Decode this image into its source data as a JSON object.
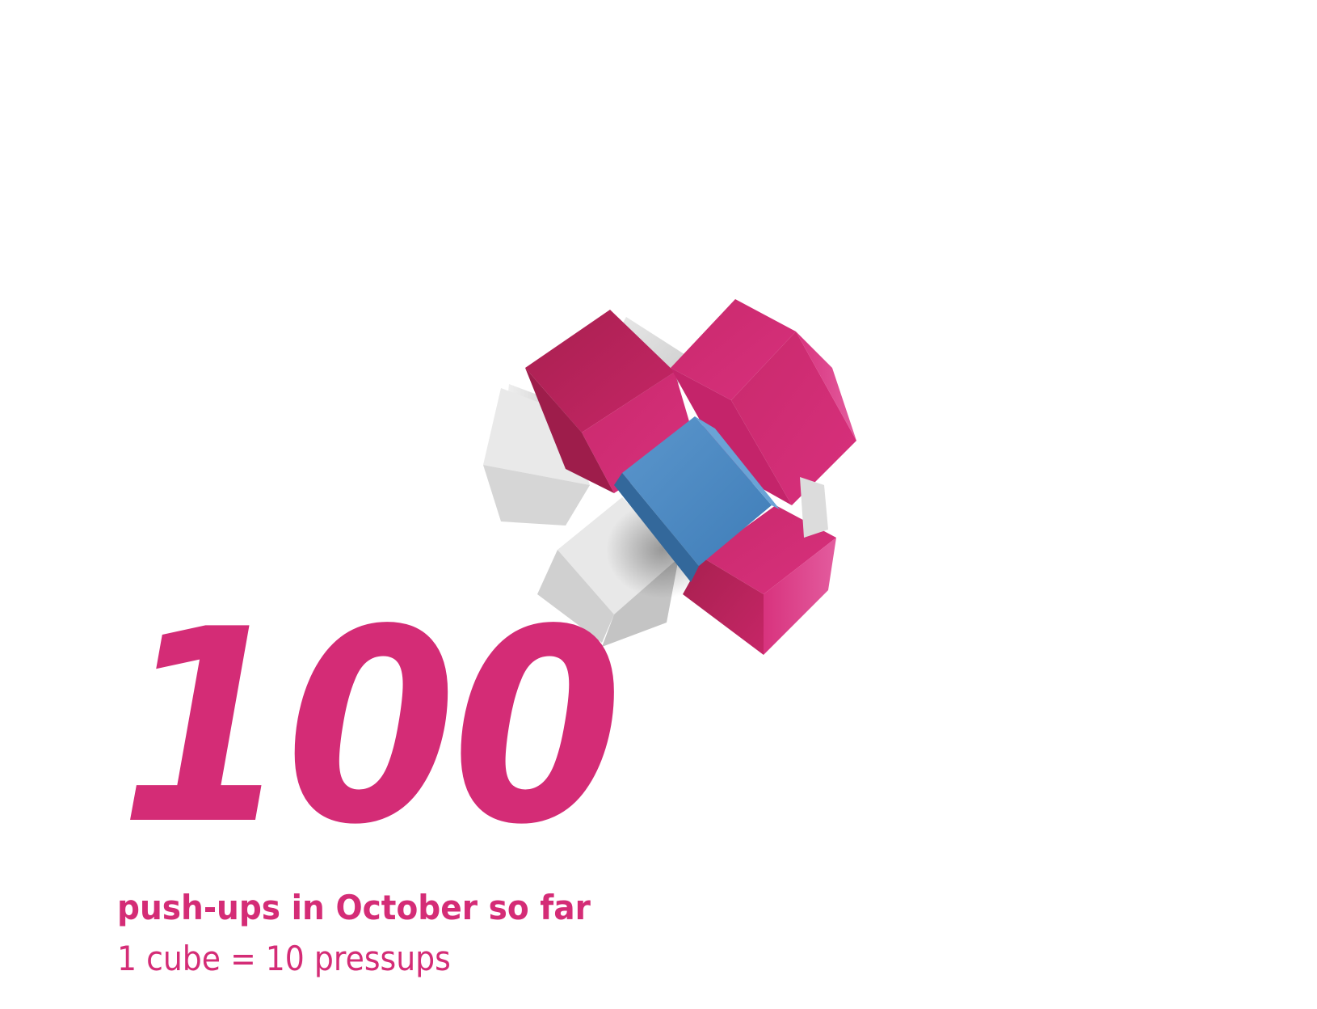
{
  "count_label": "100",
  "caption": "push-ups in October so far",
  "legend": "1 cube = 10 pressups",
  "cubes": {
    "accent_color": "#d42c76",
    "highlight_color": "#4a86bf",
    "empty_color": "#d4d4d4",
    "filled_count": 4,
    "highlighted_count": 1,
    "empty_count": 3
  }
}
